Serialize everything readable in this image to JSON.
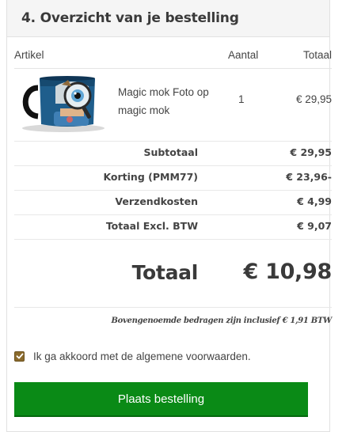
{
  "section": {
    "title": "4. Overzicht van je bestelling"
  },
  "table": {
    "headers": {
      "article": "Artikel",
      "quantity": "Aantal",
      "total": "Totaal"
    },
    "items": [
      {
        "image_icon": "magic-mug-photo",
        "name": "Magic mok Foto op magic mok",
        "quantity": "1",
        "price": "€ 29,95"
      }
    ]
  },
  "summary": [
    {
      "label": "Subtotaal",
      "value": "€ 29,95"
    },
    {
      "label": "Korting (PMM77)",
      "value": "€ 23,96-"
    },
    {
      "label": "Verzendkosten",
      "value": "€ 4,99"
    },
    {
      "label": "Totaal Excl. BTW",
      "value": "€ 9,07"
    }
  ],
  "total": {
    "label": "Totaal",
    "value": "€ 10,98"
  },
  "vat_note": "Bovengenoemde bedragen zijn inclusief € 1,91 BTW",
  "terms": {
    "checked": true,
    "label": "Ik ga akkoord met de algemene voorwaarden."
  },
  "submit": {
    "label": "Plaats bestelling"
  },
  "colors": {
    "button": "#0a8a16",
    "checkbox": "#8a6a2c",
    "header_bg": "#f5f5f5"
  }
}
